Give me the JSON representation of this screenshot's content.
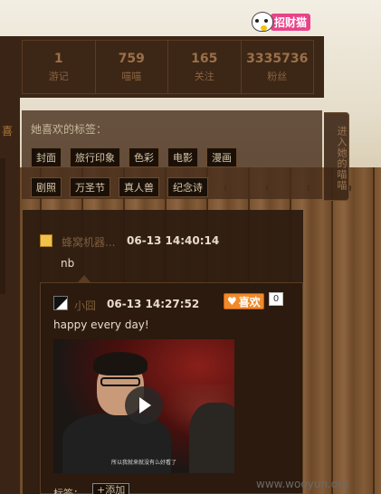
{
  "badge": {
    "label": "招财猫"
  },
  "stats": [
    {
      "num": "1",
      "label": "游记"
    },
    {
      "num": "759",
      "label": "喵喵"
    },
    {
      "num": "165",
      "label": "关注"
    },
    {
      "num": "3335736",
      "label": "粉丝"
    }
  ],
  "left_partial": "喜",
  "tags_panel": {
    "title": "她喜欢的标签：",
    "row1": [
      "封面",
      "旅行印象",
      "色彩",
      "电影",
      "漫画"
    ],
    "row2": [
      "剧照",
      "万圣节",
      "真人兽",
      "纪念诗"
    ],
    "side_tab": "进入她的喵喵"
  },
  "comment": {
    "name": "蜂窝机器...",
    "time": "06-13 14:40:14",
    "text": "nb"
  },
  "post": {
    "name": "小囧",
    "time": "06-13 14:27:52",
    "like_label": "喜欢",
    "like_count": "0",
    "text": "happy every day!",
    "video_subtitle": "所以我就来就没有么好看了",
    "tags_label": "标签：",
    "add_tag_label": "+添加"
  },
  "watermark": "www.wooyun.org"
}
